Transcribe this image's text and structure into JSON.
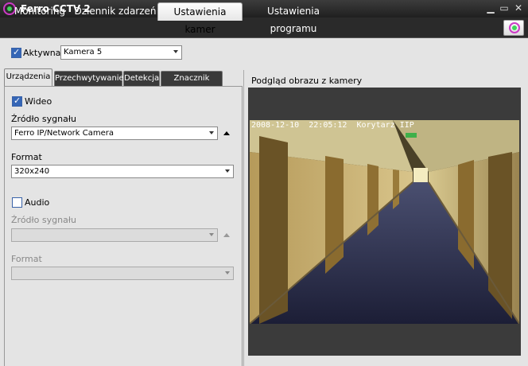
{
  "window": {
    "title": "Ferro CCTV 2"
  },
  "main_tabs": [
    {
      "label": "Monitoring"
    },
    {
      "label": "Dziennik zdarzeń"
    },
    {
      "label": "Ustawienia kamer"
    },
    {
      "label": "Ustawienia programu"
    }
  ],
  "active_main_tab": "Ustawienia kamer",
  "camera": {
    "active_label": "Aktywna",
    "active_checked": true,
    "selected": "Kamera 5"
  },
  "sub_tabs": [
    {
      "label": "Urządzenia"
    },
    {
      "label": "Przechwytywanie"
    },
    {
      "label": "Detekcja"
    },
    {
      "label": "Znacznik czasu"
    }
  ],
  "active_sub_tab": "Urządzenia",
  "device": {
    "video_label": "Wideo",
    "video_checked": true,
    "video_source_label": "Źródło sygnału",
    "video_source_value": "Ferro IP/Network Camera",
    "video_format_label": "Format",
    "video_format_value": "320x240",
    "audio_label": "Audio",
    "audio_checked": false,
    "audio_source_label": "Źródło sygnału",
    "audio_source_value": "",
    "audio_format_label": "Format",
    "audio_format_value": ""
  },
  "preview": {
    "title": "Podgląd obrazu z kamery",
    "osd_date": "2008-12-10",
    "osd_time": "22:05:12",
    "osd_name": "Korytarz IIP"
  },
  "icons": {
    "app": "ferro-logo-icon",
    "minimize": "minimize-icon",
    "maximize": "maximize-icon",
    "close": "close-icon"
  },
  "colors": {
    "accent": "#3566b6",
    "logo_ring": "#cc3bc6",
    "logo_dot": "#3fd45a"
  }
}
